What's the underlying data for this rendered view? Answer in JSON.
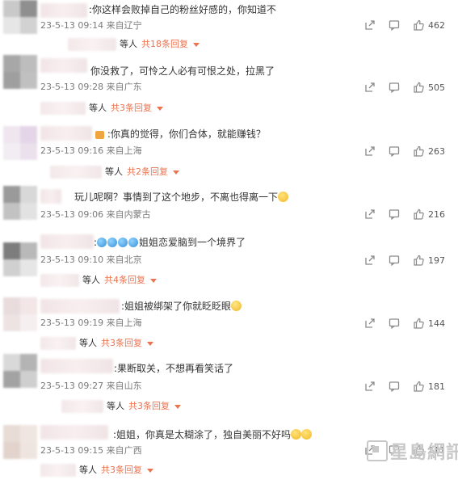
{
  "comments": [
    {
      "text": "你这样会败掉自己的粉丝好感的，你知道不",
      "prefix": ":",
      "meta": "23-5-13 09:14 来自辽宁",
      "likes": "462",
      "reply_count": "共18条回复",
      "reply_prefix": "等人"
    },
    {
      "text": "你没救了，可怜之人必有可恨之处，拉黑了",
      "prefix": "",
      "meta": "23-5-13 09:28 来自广东",
      "likes": "505",
      "reply_count": "共3条回复",
      "reply_prefix": "等人"
    },
    {
      "text": ":你真的觉得，你们合体，就能赚钱？",
      "prefix": "",
      "meta": "23-5-13 09:16 来自上海",
      "likes": "263",
      "reply_count": "共2条回复",
      "reply_prefix": "等人"
    },
    {
      "text": "玩儿呢啊？事情到了这个地步，不离也得离一下",
      "prefix": "",
      "meta": "23-5-13 09:06 来自内蒙古",
      "likes": "216",
      "reply_count": "",
      "reply_prefix": ""
    },
    {
      "text": "姐姐恋爱脑到一个境界了",
      "prefix": ":",
      "meta": "23-5-13 09:10 来自北京",
      "likes": "197",
      "reply_count": "共4条回复",
      "reply_prefix": "等人"
    },
    {
      "text": ":姐姐被绑架了你就眨眨眼",
      "prefix": "",
      "meta": "23-5-13 09:19 来自上海",
      "likes": "144",
      "reply_count": "共3条回复",
      "reply_prefix": "等人"
    },
    {
      "text": ":果断取关，不想再看笑话了",
      "prefix": "",
      "meta": "23-5-13 09:27 来自山东",
      "likes": "181",
      "reply_count": "共3条回复",
      "reply_prefix": "等人"
    },
    {
      "text": ":姐姐，你真是太糊涂了，独自美丽不好吗",
      "prefix": "",
      "meta": "23-5-13 09:15 来自广西",
      "likes": "111",
      "reply_count": "共3条回复",
      "reply_prefix": "等人"
    }
  ],
  "icons": {
    "share": "share-icon",
    "comment": "comment-icon",
    "like": "thumbs-up-icon"
  },
  "colors": {
    "reply_link": "#eb7350",
    "meta": "#7a7a7a",
    "icon": "#8a8a8a"
  },
  "watermark": "星島網訊"
}
